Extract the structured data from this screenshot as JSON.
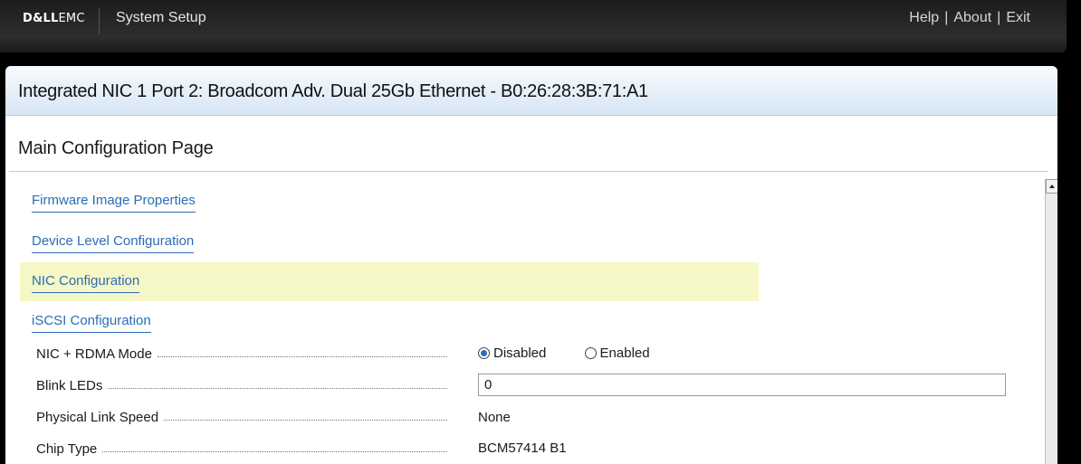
{
  "topbar": {
    "brand_dell": "D&LL",
    "brand_emc": "EMC",
    "title": "System Setup",
    "links": [
      "Help",
      "About",
      "Exit"
    ]
  },
  "header": {
    "nic_title": "Integrated NIC 1 Port 2: Broadcom Adv. Dual 25Gb Ethernet - B0:26:28:3B:71:A1"
  },
  "main": {
    "page_title": "Main Configuration Page",
    "nav_links": [
      "Firmware Image Properties",
      "Device Level Configuration",
      "NIC Configuration",
      "iSCSI Configuration"
    ],
    "highlighted_link": "NIC Configuration",
    "fields": {
      "rdma": {
        "label": "NIC + RDMA Mode",
        "options": [
          "Disabled",
          "Enabled"
        ],
        "selected": "Disabled"
      },
      "blink": {
        "label": "Blink LEDs",
        "value": "0"
      },
      "link_speed": {
        "label": "Physical Link Speed",
        "value": "None"
      },
      "chip_type": {
        "label": "Chip Type",
        "value": "BCM57414 B1"
      }
    }
  },
  "colors": {
    "link": "#2a6db5",
    "highlight": "#f5f7c6",
    "header_gradient_end": "#d5e6f4"
  }
}
